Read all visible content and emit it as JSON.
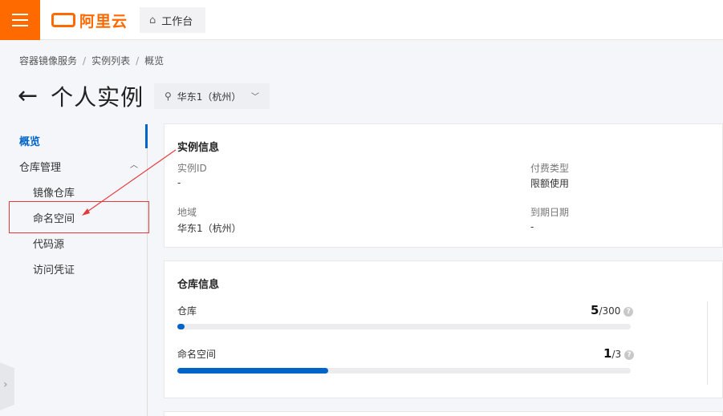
{
  "topbar": {
    "menu_icon": "hamburger-icon",
    "logo_text": "阿里云",
    "workbench_label": "工作台",
    "workbench_icon": "home-icon",
    "brand_color": "#ff6a00"
  },
  "breadcrumb": [
    "容器镜像服务",
    "实例列表",
    "概览"
  ],
  "header": {
    "title": "个人实例",
    "back_icon": "arrow-left-icon",
    "region": "华东1（杭州）",
    "region_icon": "location-pin-icon"
  },
  "sidebar": {
    "overview": "概览",
    "repo_mgmt": "仓库管理",
    "items": [
      "镜像仓库",
      "命名空间",
      "代码源",
      "访问凭证"
    ],
    "accent": "#0064c8"
  },
  "instance_info": {
    "title": "实例信息",
    "instance_id_label": "实例ID",
    "instance_id_value": "-",
    "billing_label": "付费类型",
    "billing_value": "限额使用",
    "region_label": "地域",
    "region_value": "华东1（杭州）",
    "expiry_label": "到期日期",
    "expiry_value": "-"
  },
  "repo_info": {
    "title": "仓库信息",
    "repos": {
      "label": "仓库",
      "used": "5",
      "limit": "/300",
      "fill": 0.0167
    },
    "namespaces": {
      "label": "命名空间",
      "used": "1",
      "limit": "/3",
      "fill": 0.3333
    }
  },
  "annotation_color": "#e43a3a"
}
